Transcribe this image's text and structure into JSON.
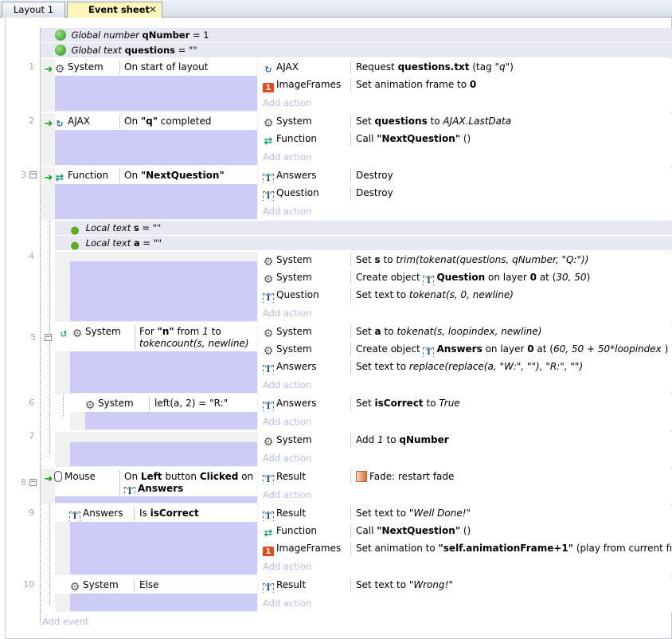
{
  "tabs": [
    {
      "label": "Layout 1"
    },
    {
      "label": "Event sheet 1"
    }
  ],
  "tab_close": "✕",
  "globals": [
    {
      "kind": "Global number",
      "name": "qNumber",
      "value": "= 1"
    },
    {
      "kind": "Global text",
      "name": "questions",
      "value": "= \"\""
    }
  ],
  "row_numbers": [
    "1",
    "2",
    "3",
    "4",
    "5",
    "6",
    "7",
    "8",
    "9",
    "10"
  ],
  "events": {
    "e1": {
      "object": "System",
      "condition": "On start of layout",
      "actions": [
        {
          "object": "AJAX",
          "t1": "Request ",
          "b1": "questions.txt",
          "t2": " (tag ",
          "i1": "\"q\"",
          "t3": ")"
        },
        {
          "object": "ImageFrames",
          "t1": "Set animation frame to ",
          "b1": "0"
        }
      ]
    },
    "e2": {
      "object": "AJAX",
      "cond_t1": "On ",
      "cond_b1": "\"q\"",
      "cond_t2": " completed",
      "actions": [
        {
          "object": "System",
          "t1": "Set ",
          "b1": "questions",
          "t2": " to ",
          "i1": "AJAX.LastData"
        },
        {
          "object": "Function",
          "t1": "Call ",
          "b1": "\"NextQuestion\"",
          "t2": " ()"
        }
      ]
    },
    "e3": {
      "object": "Function",
      "cond_t1": "On ",
      "cond_b1": "\"NextQuestion\"",
      "actions": [
        {
          "object": "Answers",
          "text": "Destroy"
        },
        {
          "object": "Question",
          "text": "Destroy"
        }
      ]
    },
    "e4": {
      "locals": [
        {
          "kind": "Local text",
          "name": "s",
          "value": "= \"\""
        },
        {
          "kind": "Local text",
          "name": "a",
          "value": "= \"\""
        }
      ],
      "actions": [
        {
          "object": "System",
          "t1": "Set ",
          "b1": "s",
          "t2": " to ",
          "i1": "trim(tokenat(questions, qNumber, \"Q:\"))"
        },
        {
          "object": "System",
          "t1": "Create object ",
          "b1": "Question",
          "t2": " on layer ",
          "b2": "0",
          "t3": " at (",
          "i1": "30, 50",
          "t4": ")"
        },
        {
          "object": "Question",
          "t1": "Set text to ",
          "i1": "tokenat(s, 0, newline)"
        }
      ]
    },
    "e5": {
      "object": "System",
      "cond_t1": "For ",
      "cond_b1": "\"n\"",
      "cond_t2": " from ",
      "cond_i1": "1",
      "cond_t3": " to",
      "cond_line2": "tokencount(s, newline)",
      "actions": [
        {
          "object": "System",
          "t1": "Set ",
          "b1": "a",
          "t2": " to ",
          "i1": "tokenat(s, loopindex, newline)"
        },
        {
          "object": "System",
          "t1": "Create object ",
          "b1": "Answers",
          "t2": " on layer ",
          "b2": "0",
          "t3": " at (",
          "i1": "60, 50 + 50*loopindex",
          "t4": " )"
        },
        {
          "object": "Answers",
          "t1": "Set text to ",
          "i1": "replace(replace(a, \"W:\", \"\"), \"R:\", \"\")"
        }
      ]
    },
    "e6": {
      "object": "System",
      "condition": "left(a, 2) = \"R:\"",
      "actions": [
        {
          "object": "Answers",
          "t1": "Set ",
          "b1": "isCorrect",
          "t2": " to ",
          "i1": "True"
        }
      ]
    },
    "e7": {
      "actions": [
        {
          "object": "System",
          "t1": "Add ",
          "i1": "1",
          "t2": " to ",
          "b1": "qNumber"
        }
      ]
    },
    "e8": {
      "object": "Mouse",
      "cond_t1": "On ",
      "cond_b1": "Left",
      "cond_t2": " button ",
      "cond_b2": "Clicked",
      "cond_t3": " on",
      "cond_b3": "Answers",
      "actions": [
        {
          "object": "Result",
          "text": "Fade: restart fade"
        }
      ]
    },
    "e9": {
      "object": "Answers",
      "cond_t1": "Is ",
      "cond_b1": "isCorrect",
      "actions": [
        {
          "object": "Result",
          "t1": "Set text to ",
          "i1": "\"Well Done!\""
        },
        {
          "object": "Function",
          "t1": "Call ",
          "b1": "\"NextQuestion\"",
          "t2": " ()"
        },
        {
          "object": "ImageFrames",
          "t1": "Set animation to ",
          "b1": "\"self.animationFrame+1\"",
          "t2": " (play from current frame)"
        }
      ]
    },
    "e10": {
      "object": "System",
      "condition": "Else",
      "actions": [
        {
          "object": "Result",
          "t1": "Set text to ",
          "i1": "\"Wrong!\""
        }
      ]
    }
  },
  "add_action": "Add action",
  "add_event": "Add event",
  "icons": {
    "globe": "globe-icon",
    "gear": "gear-icon",
    "arrow": "green-arrow-icon",
    "ajax": "ajax-icon",
    "frames": "imageframes-icon",
    "func": "function-icon",
    "text": "text-object-icon",
    "pin": "local-variable-pin-icon",
    "mouse": "mouse-icon",
    "fade": "fade-behavior-icon",
    "loop": "loop-icon"
  },
  "colors": {
    "condition_fill": "#ccccf6",
    "add_link": "#b8bde6",
    "tab_active": "#fdf6b8"
  }
}
